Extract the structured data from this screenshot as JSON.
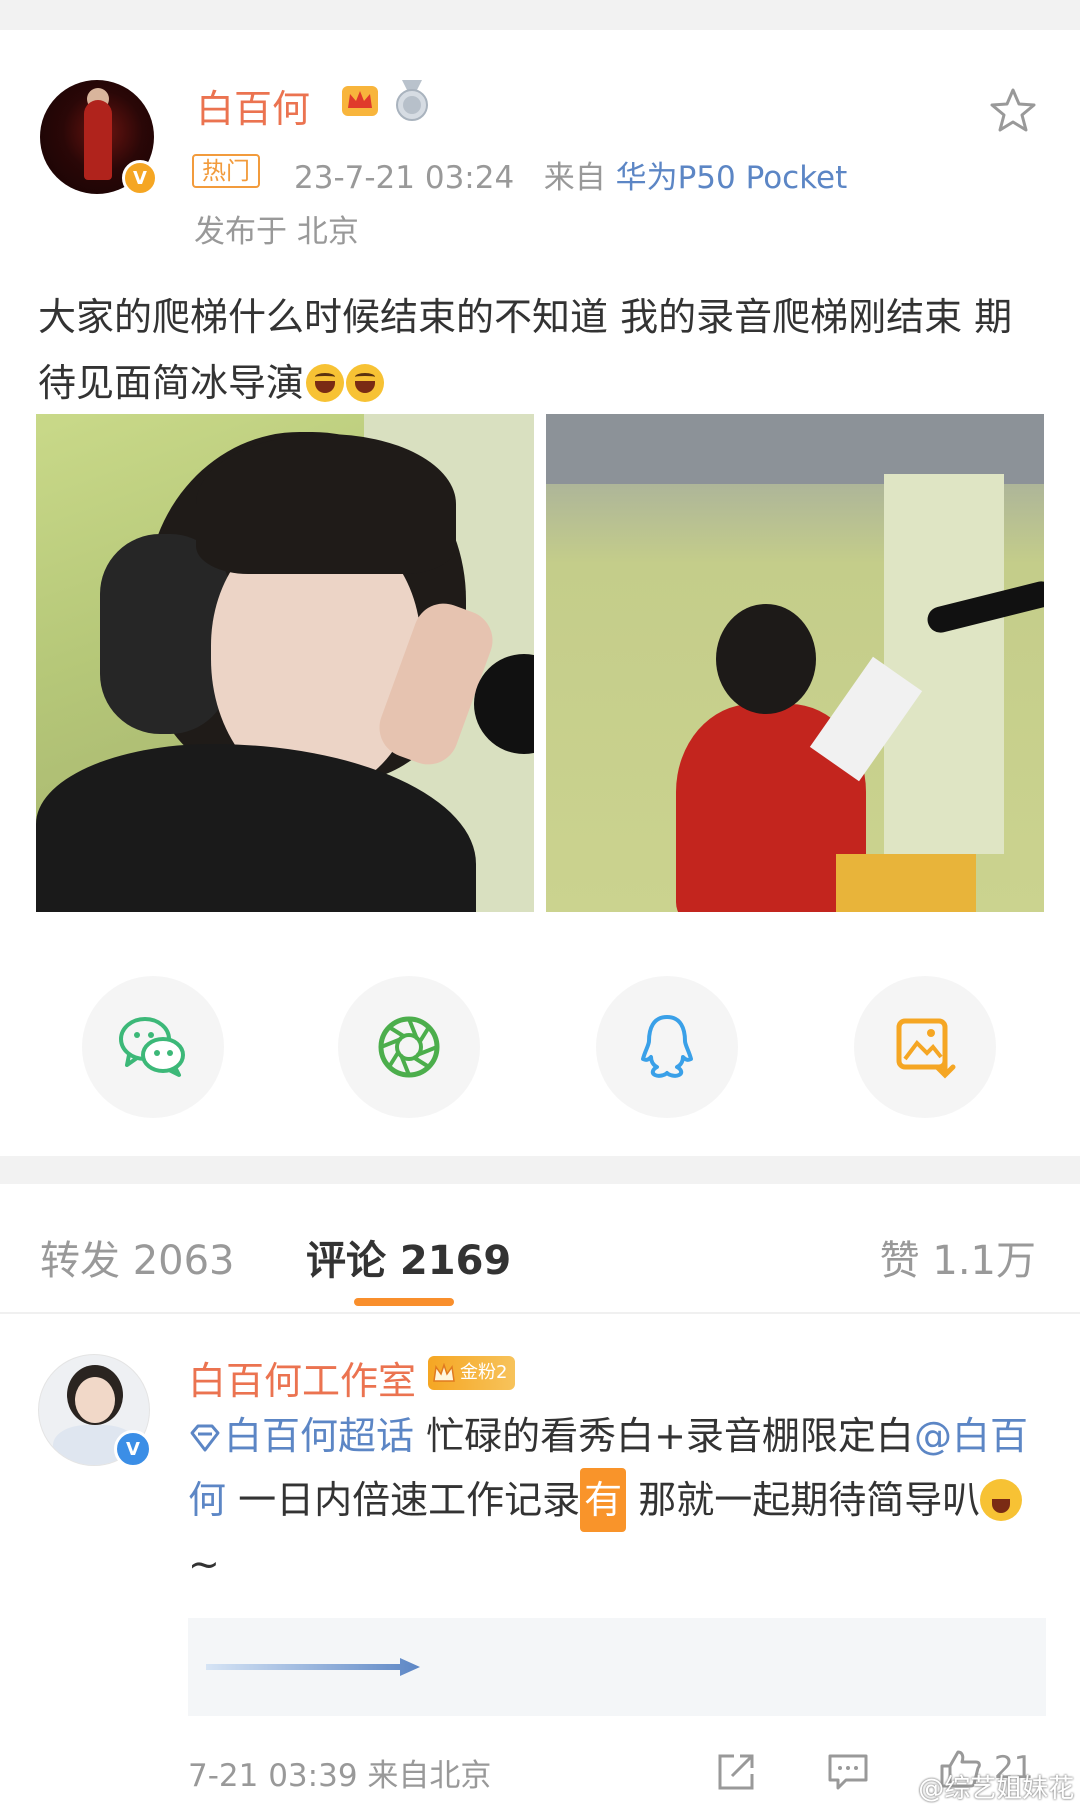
{
  "post": {
    "username": "白百何",
    "hot_tag": "热门",
    "date": "23-7-21 03:24",
    "source_prefix": "来自",
    "device": "华为P50 Pocket",
    "location": "发布于 北京",
    "text": "大家的爬梯什么时候结束的不知道  我的录音爬梯刚结束 期待见面简冰导演"
  },
  "share": {
    "items": [
      "wechat-icon",
      "moments-icon",
      "qq-icon",
      "save-image-icon"
    ],
    "colors": {
      "wechat": "#3cb878",
      "moments": "#4cae4c",
      "qq": "#3aa0e8",
      "save": "#f5a623"
    }
  },
  "tabs": {
    "forward": "转发 2063",
    "comment": "评论 2169",
    "like": "赞 1.1万"
  },
  "comment": {
    "username": "白百何工作室",
    "fan_badge": "金粉2",
    "topic": "白百何超话",
    "text_1": " 忙碌的看秀白+录音棚限定白",
    "mention": "@白百何",
    "text_2": "  一日内倍速工作记录",
    "you_badge": "有",
    "text_3": " 那就一起期待简导叭",
    "text_4": " ~",
    "time": "7-21 03:39",
    "source": "来自北京",
    "like_count": "21"
  },
  "watermark": "@综艺姐妹花",
  "colors": {
    "accent": "#eb7350",
    "link": "#5c86c5",
    "tab_underline": "#f98f2c",
    "muted": "#999999"
  }
}
